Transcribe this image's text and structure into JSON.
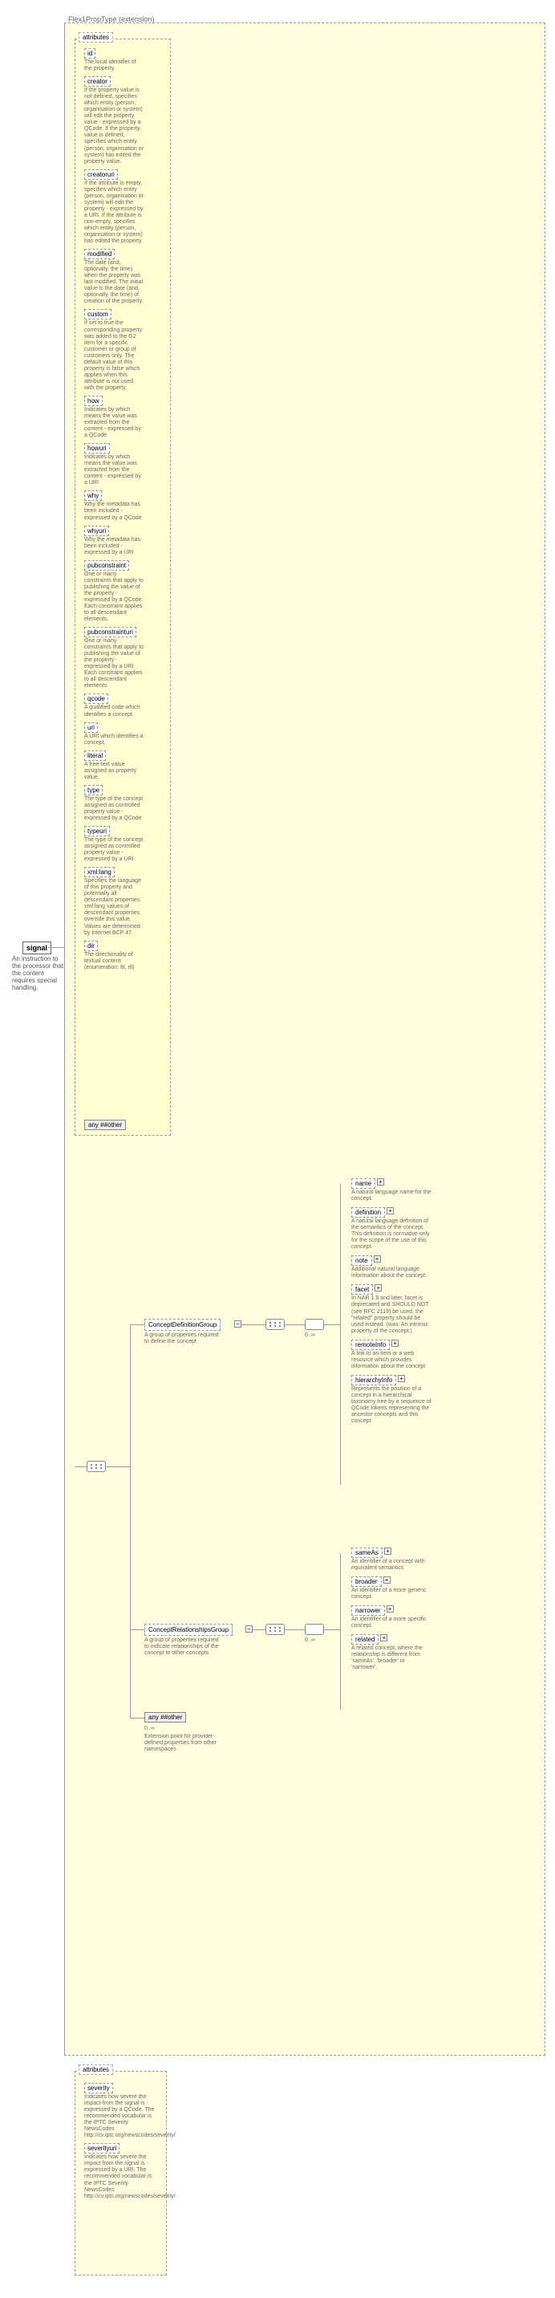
{
  "extension_title": "Flex1PropType (extension)",
  "root": {
    "label": "signal",
    "desc": "An instruction to the processor that the content requires special handling."
  },
  "attributes_label": "attributes",
  "attrs": [
    {
      "name": "id",
      "desc": "The local identifier of the property."
    },
    {
      "name": "creator",
      "desc": "If the property value is not defined, specifies which entity (person, organisation or system) will edit the property value - expressed by a QCode. If the property value is defined, specifies which entity (person, organisation or system) has edited the property value."
    },
    {
      "name": "creatoruri",
      "desc": "If the attribute is empty, specifies which entity (person, organisation or system) will edit the property - expressed by a URI. If the attribute is non-empty, specifies which entity (person, organisation or system) has edited the property."
    },
    {
      "name": "modified",
      "desc": "The date (and, optionally, the time) when the property was last modified. The initial value is the date (and, optionally, the time) of creation of the property."
    },
    {
      "name": "custom",
      "desc": "If set to true the corresponding property was added to the G2 item for a specific customer or group of customers only. The default value of this property is false which applies when this attribute is not used with the property."
    },
    {
      "name": "how",
      "desc": "Indicates by which means the value was extracted from the content - expressed by a QCode"
    },
    {
      "name": "howuri",
      "desc": "Indicates by which means the value was extracted from the content - expressed by a URI"
    },
    {
      "name": "why",
      "desc": "Why the metadata has been included - expressed by a QCode"
    },
    {
      "name": "whyuri",
      "desc": "Why the metadata has been included - expressed by a URI"
    },
    {
      "name": "pubconstraint",
      "desc": "One or many constraints that apply to publishing the value of the property - expressed by a QCode. Each constraint applies to all descendant elements."
    },
    {
      "name": "pubconstrainturi",
      "desc": "One or many constraints that apply to publishing the value of the property - expressed by a URI. Each constraint applies to all descendant elements."
    },
    {
      "name": "qcode",
      "desc": "A qualified code which identifies a concept."
    },
    {
      "name": "uri",
      "desc": "A URI which identifies a concept."
    },
    {
      "name": "literal",
      "desc": "A free-text value assigned as property value."
    },
    {
      "name": "type",
      "desc": "The type of the concept assigned as controlled property value - expressed by a QCode"
    },
    {
      "name": "typeuri",
      "desc": "The type of the concept assigned as controlled property value - expressed by a URI"
    },
    {
      "name": "xml:lang",
      "desc": "Specifies the language of this property and potentially all descendant properties. xml:lang values of descendant properties override this value. Values are determined by Internet BCP 47."
    },
    {
      "name": "dir",
      "desc": "The directionality of textual content (enumeration: ltr, rtl)"
    }
  ],
  "any_attr": "any ##other",
  "cdg": {
    "label": "ConceptDefinitionGroup",
    "desc": "A group of properties required to define the concept"
  },
  "crg": {
    "label": "ConceptRelationshipsGroup",
    "desc": "A group of properties required to indicate relationships of the concept to other concepts"
  },
  "any_elem": {
    "label": "any ##other",
    "card": "0..∞",
    "desc": "Extension point for provider-defined properties from other namespaces"
  },
  "cdg_leaves": [
    {
      "name": "name",
      "desc": "A natural language name for the concept."
    },
    {
      "name": "definition",
      "desc": "A natural language definition of the semantics of the concept. This definition is normative only for the scope of the use of this concept."
    },
    {
      "name": "note",
      "desc": "Additional natural language information about the concept."
    },
    {
      "name": "facet",
      "desc": "In NAR 1.8 and later, facet is deprecated and SHOULD NOT (see RFC 2119) be used, the \"related\" property should be used instead. (was: An intrinsic property of the concept.)"
    },
    {
      "name": "remoteInfo",
      "desc": "A link to an item or a web resource which provides information about the concept"
    },
    {
      "name": "hierarchyInfo",
      "desc": "Represents the position of a concept in a hierarchical taxonomy tree by a sequence of QCode tokens representing the ancestor concepts and this concept"
    }
  ],
  "crg_leaves": [
    {
      "name": "sameAs",
      "desc": "An identifier of a concept with equivalent semantics"
    },
    {
      "name": "broader",
      "desc": "An identifier of a more generic concept."
    },
    {
      "name": "narrower",
      "desc": "An identifier of a more specific concept."
    },
    {
      "name": "related",
      "desc": "A related concept, where the relationship is different from 'sameAs', 'broader' or 'narrower'."
    }
  ],
  "severity_attrs": [
    {
      "name": "severity",
      "desc": "Indicates how severe the impact from the signal is - expressed by a QCode. The recommended vocabular is the IPTC Severity NewsCodes http://cv.iptc.org/newscodes/severity/"
    },
    {
      "name": "severityuri",
      "desc": "Indicates how severe the impact from the signal is - expressed by a URI. The recommended vocabular is the IPTC Severity NewsCodes http://cv.iptc.org/newscodes/severity/"
    }
  ],
  "card_unbounded": "0..∞"
}
